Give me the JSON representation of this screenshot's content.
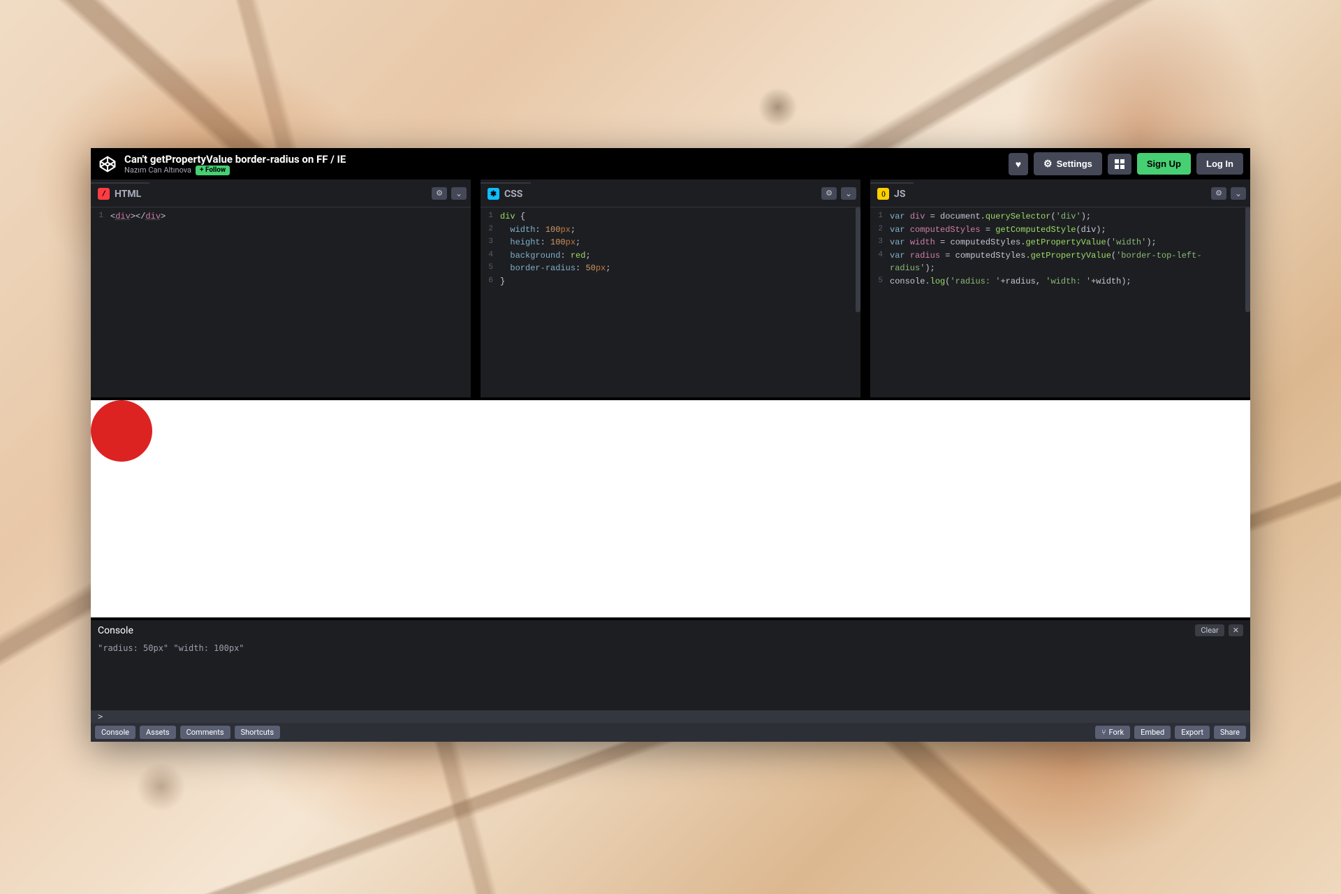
{
  "header": {
    "title": "Can't getPropertyValue border-radius on FF / IE",
    "author": "Nazım Can Altınova",
    "follow_label": "+ Follow",
    "settings_label": "Settings",
    "signup_label": "Sign Up",
    "login_label": "Log In"
  },
  "panes": {
    "html": {
      "label": "HTML"
    },
    "css": {
      "label": "CSS"
    },
    "js": {
      "label": "JS"
    }
  },
  "code": {
    "html_raw": "<div></div>",
    "css_lines": {
      "l1": "div {",
      "l2": {
        "prop": "width",
        "val": "100",
        "unit": "px"
      },
      "l3": {
        "prop": "height",
        "val": "100",
        "unit": "px"
      },
      "l4": {
        "prop": "background",
        "val": "red"
      },
      "l5": {
        "prop": "border-radius",
        "val": "50",
        "unit": "px"
      },
      "l6": "}"
    },
    "js_lines": {
      "l1_str": "'div'",
      "l2_fn": "getComputedStyle",
      "l3_str": "'width'",
      "l4_str": "'border-top-left-radius'",
      "l5_pre": "console",
      "l5_fn": "log",
      "l5_s1": "'radius: '",
      "l5_s2": "'width: '"
    }
  },
  "console": {
    "title": "Console",
    "clear_label": "Clear",
    "output": "\"radius: 50px\" \"width: 100px\"",
    "prompt": ">"
  },
  "footer": {
    "left": {
      "console": "Console",
      "assets": "Assets",
      "comments": "Comments",
      "shortcuts": "Shortcuts"
    },
    "right": {
      "fork": "Fork",
      "embed": "Embed",
      "export": "Export",
      "share": "Share"
    }
  }
}
